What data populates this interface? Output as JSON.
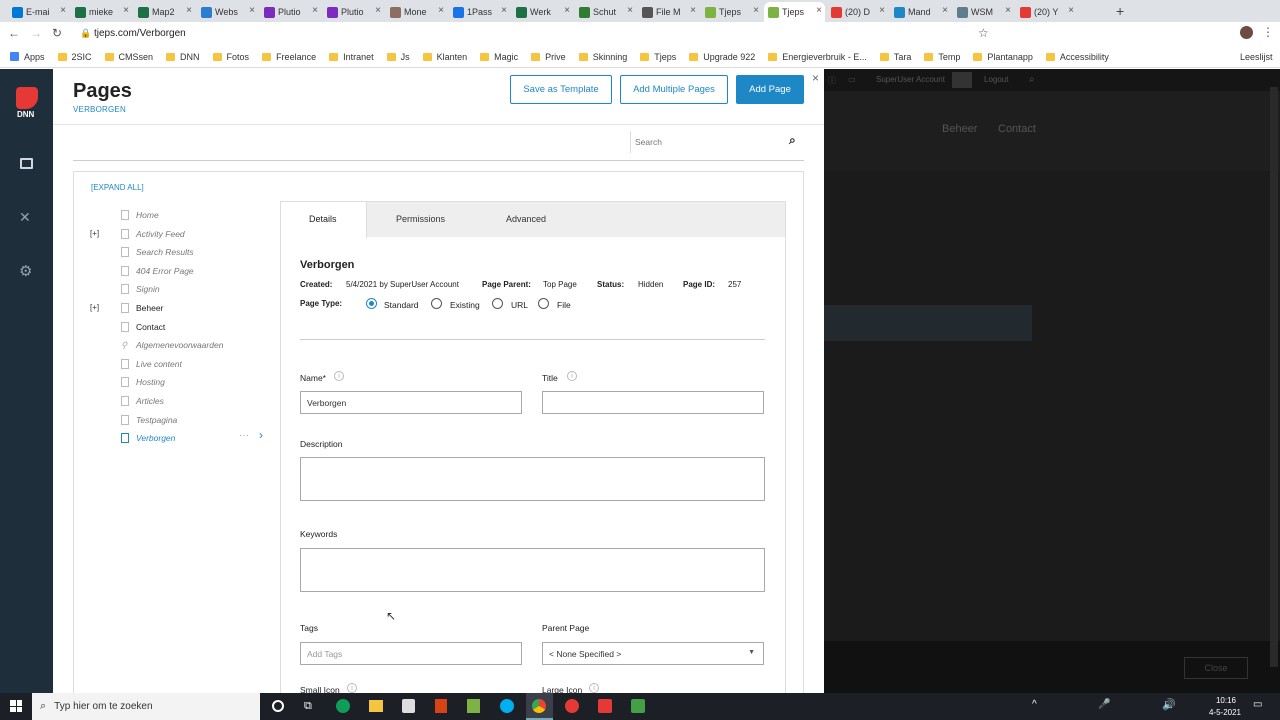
{
  "browser": {
    "tabs": [
      {
        "label": "E-mai",
        "color": "#0078d4"
      },
      {
        "label": "mieke",
        "color": "#1e7145"
      },
      {
        "label": "Map2",
        "color": "#1e7145"
      },
      {
        "label": "Webs",
        "color": "#2b7cd3"
      },
      {
        "label": "Plutio",
        "color": "#7b2cbf"
      },
      {
        "label": "Plutio",
        "color": "#7b2cbf"
      },
      {
        "label": "Mone",
        "color": "#8d6e63"
      },
      {
        "label": "1Pass",
        "color": "#1a73e8"
      },
      {
        "label": "Werk",
        "color": "#1e7145"
      },
      {
        "label": "Schut",
        "color": "#2e7d32"
      },
      {
        "label": "File M",
        "color": "#555555"
      },
      {
        "label": "Tjeps",
        "color": "#7cb342"
      },
      {
        "label": "Tjeps",
        "color": "#7cb342"
      },
      {
        "label": "(20) D",
        "color": "#e53935"
      },
      {
        "label": "Mand",
        "color": "#1e88c7"
      },
      {
        "label": "WSM",
        "color": "#607d8b"
      },
      {
        "label": "(20) Y",
        "color": "#e53935"
      }
    ],
    "url": "tjeps.com/Verborgen",
    "bookmarks": [
      "Apps",
      "2SIC",
      "CMSsen",
      "DNN",
      "Fotos",
      "Freelance",
      "Intranet",
      "Js",
      "Klanten",
      "Magic",
      "Prive",
      "Skinning",
      "Tjeps",
      "Upgrade 922",
      "Energieverbruik - E...",
      "Tara",
      "Temp",
      "Plantanapp",
      "Accessibility"
    ],
    "reading_list": "Leeslijst"
  },
  "header": {
    "title": "Pages",
    "subtitle": "VERBORGEN",
    "save_template": "Save as Template",
    "add_multiple": "Add Multiple Pages",
    "add_page": "Add Page",
    "search_placeholder": "Search",
    "close": "×"
  },
  "tree": {
    "expand_all": "[EXPAND ALL]",
    "items": [
      {
        "label": "Home",
        "toggle": ""
      },
      {
        "label": "Activity Feed",
        "toggle": "[+]"
      },
      {
        "label": "Search Results",
        "toggle": ""
      },
      {
        "label": "404 Error Page",
        "toggle": ""
      },
      {
        "label": "Signin",
        "toggle": ""
      },
      {
        "label": "Beheer",
        "toggle": "[+]"
      },
      {
        "label": "Contact",
        "toggle": ""
      },
      {
        "label": "Algemenevoorwaarden",
        "toggle": ""
      },
      {
        "label": "Live content",
        "toggle": ""
      },
      {
        "label": "Hosting",
        "toggle": ""
      },
      {
        "label": "Articles",
        "toggle": ""
      },
      {
        "label": "Testpagina",
        "toggle": ""
      },
      {
        "label": "Verborgen",
        "toggle": ""
      }
    ]
  },
  "details": {
    "tabs": [
      "Details",
      "Permissions",
      "Advanced"
    ],
    "page_name": "Verborgen",
    "created_label": "Created:",
    "created_value": "5/4/2021 by SuperUser Account",
    "parent_label": "Page Parent:",
    "parent_value": "Top Page",
    "status_label": "Status:",
    "status_value": "Hidden",
    "id_label": "Page ID:",
    "id_value": "257",
    "type_label": "Page Type:",
    "types": [
      "Standard",
      "Existing",
      "URL",
      "File"
    ],
    "name_label": "Name*",
    "name_value": "Verborgen",
    "title_label": "Title",
    "description_label": "Description",
    "keywords_label": "Keywords",
    "tags_label": "Tags",
    "tags_placeholder": "Add Tags",
    "parent_page_label": "Parent Page",
    "parent_page_value": "< None Specified >",
    "small_icon_label": "Small Icon",
    "large_icon_label": "Large Icon"
  },
  "background_site": {
    "account": "SuperUser Account",
    "logout": "Logout",
    "nav": [
      "Beheer",
      "Contact"
    ],
    "close_btn": "Close"
  },
  "taskbar": {
    "search_placeholder": "Typ hier om te zoeken",
    "time": "10:16",
    "date": "4-5-2021"
  }
}
